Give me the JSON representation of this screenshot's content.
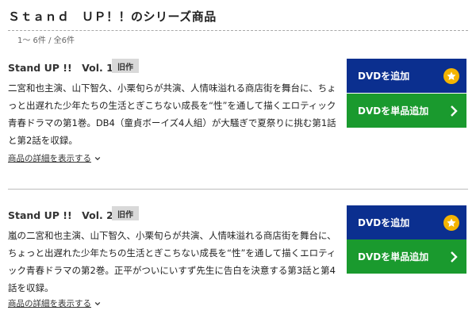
{
  "header": {
    "title": "Ｓｔａｎｄ　ＵＰ！！のシリーズ商品",
    "count": "1～ 6件 / 全6件"
  },
  "items": [
    {
      "name": "Stand UP !!　Vol. 1",
      "badge": "旧作",
      "description": "二宮和也主演、山下智久、小栗旬らが共演、人情味溢れる商店街を舞台に、ちょっと出遅れた少年たちの生活とぎこちない成長を“性”を通して描くエロティック青春ドラマの第1巻。DB4（童貞ボーイズ4人組）が大騒ぎで夏祭りに挑む第1話と第2話を収録。",
      "detail_link": "商品の詳細を表示する",
      "add_button": "DVDを追加",
      "single_button": "DVDを単品追加"
    },
    {
      "name": "Stand UP !!　Vol. 2",
      "badge": "旧作",
      "description": "嵐の二宮和也主演、山下智久、小栗旬らが共演、人情味溢れる商店街を舞台に、ちょっと出遅れた少年たちの生活とぎこちない成長を“性”を通して描くエロティック青春ドラマの第2巻。正平がついにいすず先生に告白を決意する第3話と第4話を収録。",
      "detail_link": "商品の詳細を表示する",
      "add_button": "DVDを追加",
      "single_button": "DVDを単品追加"
    }
  ],
  "colors": {
    "add_button": "#0b2f8f",
    "single_button": "#1a9a2e",
    "star": "#f5b400",
    "badge": "#d9d9d9"
  },
  "icons": {
    "add_button_icon": "star-icon",
    "single_button_icon": "chevron-right-icon",
    "detail_link_icon": "chevron-down-icon"
  }
}
